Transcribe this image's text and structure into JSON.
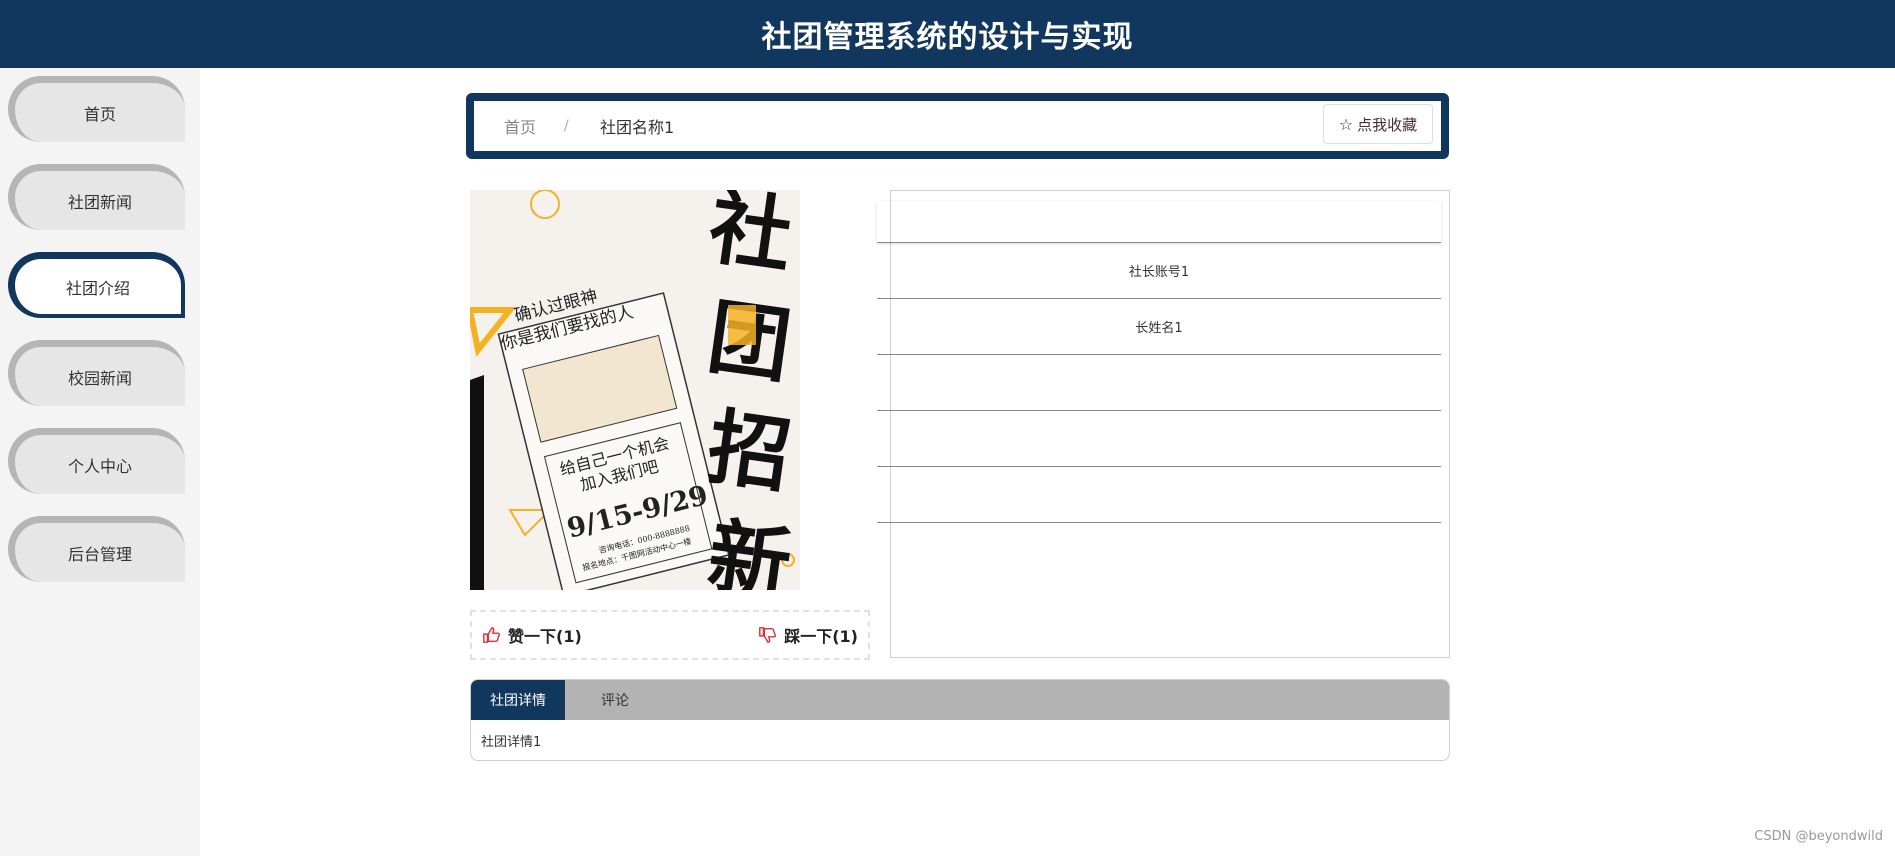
{
  "header": {
    "title": "社团管理系统的设计与实现"
  },
  "sidebar": {
    "items": [
      {
        "label": "首页"
      },
      {
        "label": "社团新闻"
      },
      {
        "label": "社团介绍"
      },
      {
        "label": "校园新闻"
      },
      {
        "label": "个人中心"
      },
      {
        "label": "后台管理"
      }
    ],
    "active_index": 2
  },
  "breadcrumb": {
    "home": "首页",
    "separator": "/",
    "current": "社团名称1"
  },
  "favorite_button": {
    "label": "点我收藏"
  },
  "poster": {
    "headline": "社团招新",
    "line1": "确认过眼神",
    "line2": "你是我们要找的人",
    "line3": "给自己一个机会",
    "line4": "加入我们吧",
    "dates": "9/15-9/29",
    "contact": "咨询电话：000-8888888",
    "address": "报名地点：千图网活动中心一楼"
  },
  "votes": {
    "like": "赞一下(1)",
    "dislike": "踩一下(1)"
  },
  "info": {
    "rows": [
      {
        "value": ""
      },
      {
        "value": "社长账号1"
      },
      {
        "value": "长姓名1"
      },
      {
        "value": ""
      },
      {
        "value": ""
      },
      {
        "value": ""
      }
    ]
  },
  "tabs": {
    "items": [
      {
        "label": "社团详情"
      },
      {
        "label": "评论"
      }
    ],
    "content": "社团详情1"
  },
  "watermark": "CSDN @beyondwild",
  "colors": {
    "primary": "#12375e",
    "sidebar_bg": "#f4f4f4",
    "tab_bar": "#b3b3b3",
    "accent_yellow": "#f4b223"
  }
}
